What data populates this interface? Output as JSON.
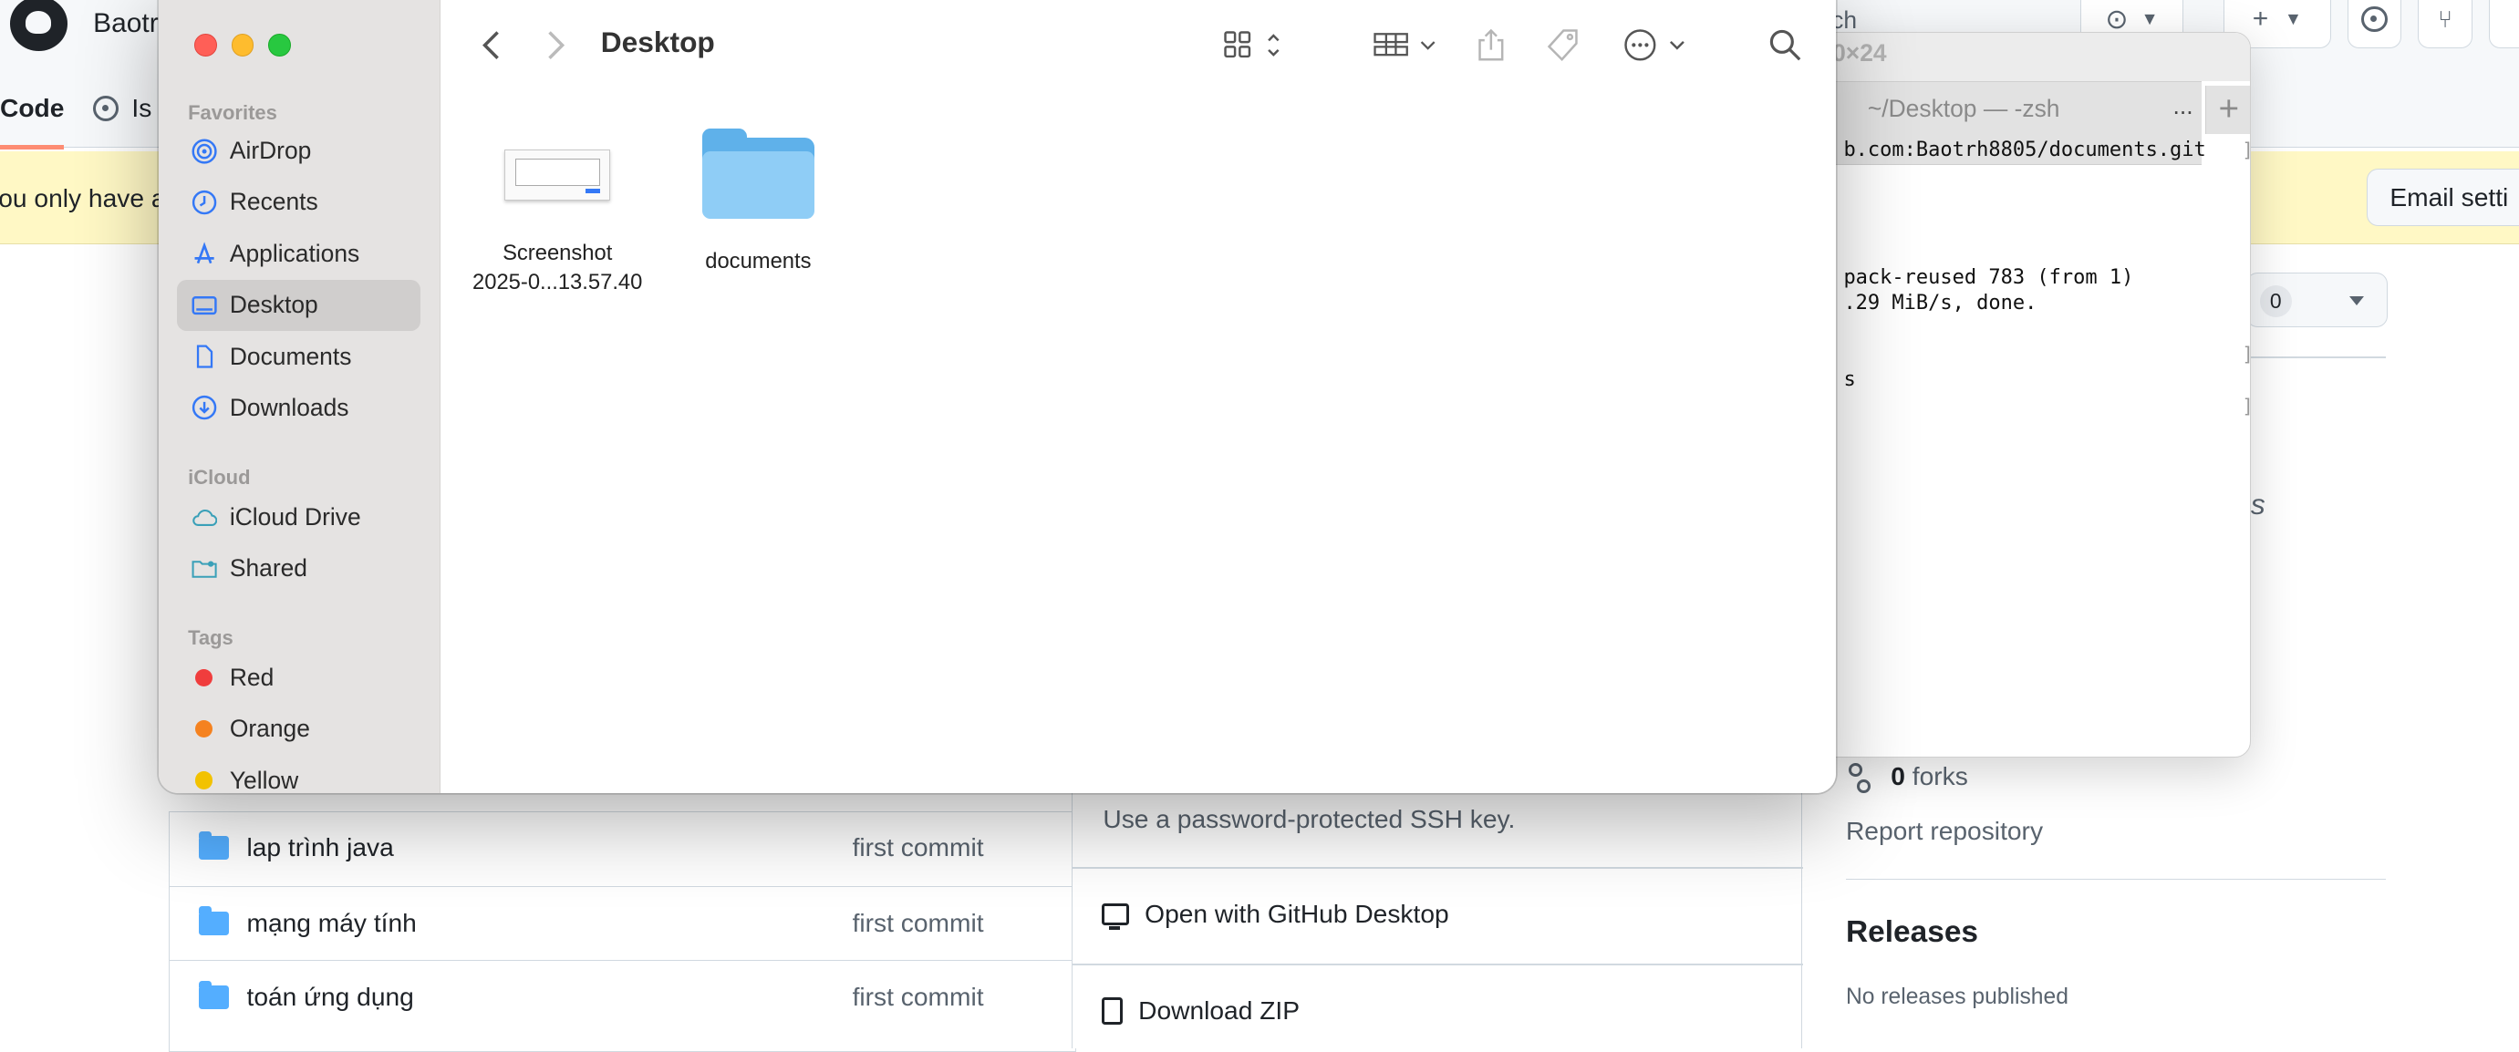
{
  "github": {
    "owner": "Baotr",
    "search": "ch",
    "tabs": {
      "code": "Code",
      "issues": "Is"
    },
    "banner": "ou only have a",
    "email_button": "Email setti",
    "star_count": "0",
    "topics_text": "ics",
    "forks_count": "0",
    "forks_label": "forks",
    "report": "Report repository",
    "releases_title": "Releases",
    "releases_empty": "No releases published",
    "files": [
      {
        "name": "lap trình java",
        "message": "first commit"
      },
      {
        "name": "mạng máy tính",
        "message": "first commit"
      },
      {
        "name": "toán ứng dụng",
        "message": "first commit"
      }
    ],
    "clone": {
      "ssh_note": "Use a password-protected SSH key.",
      "open_desktop": "Open with GitHub Desktop",
      "download_zip": "Download ZIP"
    }
  },
  "terminal": {
    "size_title": "0×24",
    "tab_label": "~/Desktop — -zsh",
    "tab_more": "...",
    "new_tab": "+",
    "lines": [
      "b.com:Baotrh8805/documents.git",
      "pack-reused 783 (from 1)",
      ".29 MiB/s, done.",
      "s"
    ],
    "brackets": [
      "]",
      "]",
      "]",
      "]"
    ]
  },
  "finder": {
    "title": "Desktop",
    "sections": {
      "favorites": "Favorites",
      "icloud": "iCloud",
      "tags": "Tags"
    },
    "favorites": [
      {
        "label": "AirDrop",
        "icon": "airdrop-icon"
      },
      {
        "label": "Recents",
        "icon": "clock-icon"
      },
      {
        "label": "Applications",
        "icon": "applications-icon"
      },
      {
        "label": "Desktop",
        "icon": "desktop-icon",
        "selected": true
      },
      {
        "label": "Documents",
        "icon": "document-icon"
      },
      {
        "label": "Downloads",
        "icon": "download-icon"
      }
    ],
    "icloud": [
      {
        "label": "iCloud Drive",
        "icon": "cloud-icon"
      },
      {
        "label": "Shared",
        "icon": "shared-folder-icon"
      }
    ],
    "tags": [
      {
        "label": "Red",
        "color": "#f03d3d"
      },
      {
        "label": "Orange",
        "color": "#f5821f"
      },
      {
        "label": "Yellow",
        "color": "#f2c200"
      }
    ],
    "items": [
      {
        "line1": "Screenshot",
        "line2": "2025-0...13.57.40",
        "kind": "screenshot-thumbnail"
      },
      {
        "line1": "documents",
        "line2": "",
        "kind": "folder-icon"
      }
    ],
    "accent": "#3478f6"
  }
}
